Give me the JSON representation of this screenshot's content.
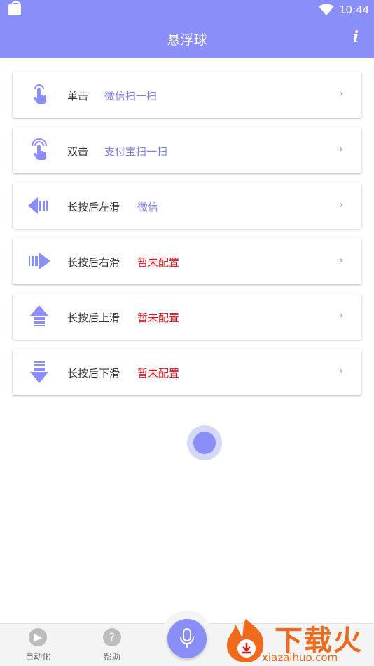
{
  "status_bar": {
    "time": "10:44"
  },
  "app_bar": {
    "title": "悬浮球",
    "info_label": "i"
  },
  "actions": [
    {
      "label": "单击",
      "value": "微信扫一扫",
      "state": "ok",
      "icon": "tap-icon"
    },
    {
      "label": "双击",
      "value": "支付宝扫一扫",
      "state": "ok",
      "icon": "double-tap-icon"
    },
    {
      "label": "长按后左滑",
      "value": "微信",
      "state": "ok",
      "icon": "arrow-left-icon"
    },
    {
      "label": "长按后右滑",
      "value": "暂未配置",
      "state": "warn",
      "icon": "arrow-right-icon"
    },
    {
      "label": "长按后上滑",
      "value": "暂未配置",
      "state": "warn",
      "icon": "arrow-up-icon"
    },
    {
      "label": "长按后下滑",
      "value": "暂未配置",
      "state": "warn",
      "icon": "arrow-down-icon"
    }
  ],
  "chevron": "›",
  "bottom_nav": {
    "automation": {
      "label": "自动化",
      "icon": "play-circle-icon"
    },
    "help": {
      "label": "帮助",
      "icon": "help-circle-icon"
    },
    "mic": {
      "icon": "microphone-icon"
    }
  },
  "watermark": {
    "title": "下载火",
    "url": "xiazaihuo.com"
  },
  "colors": {
    "accent": "#8a8ef8",
    "configured": "#7a7ee6",
    "unconfigured": "#e0141e",
    "watermark": "#f06a1d"
  }
}
